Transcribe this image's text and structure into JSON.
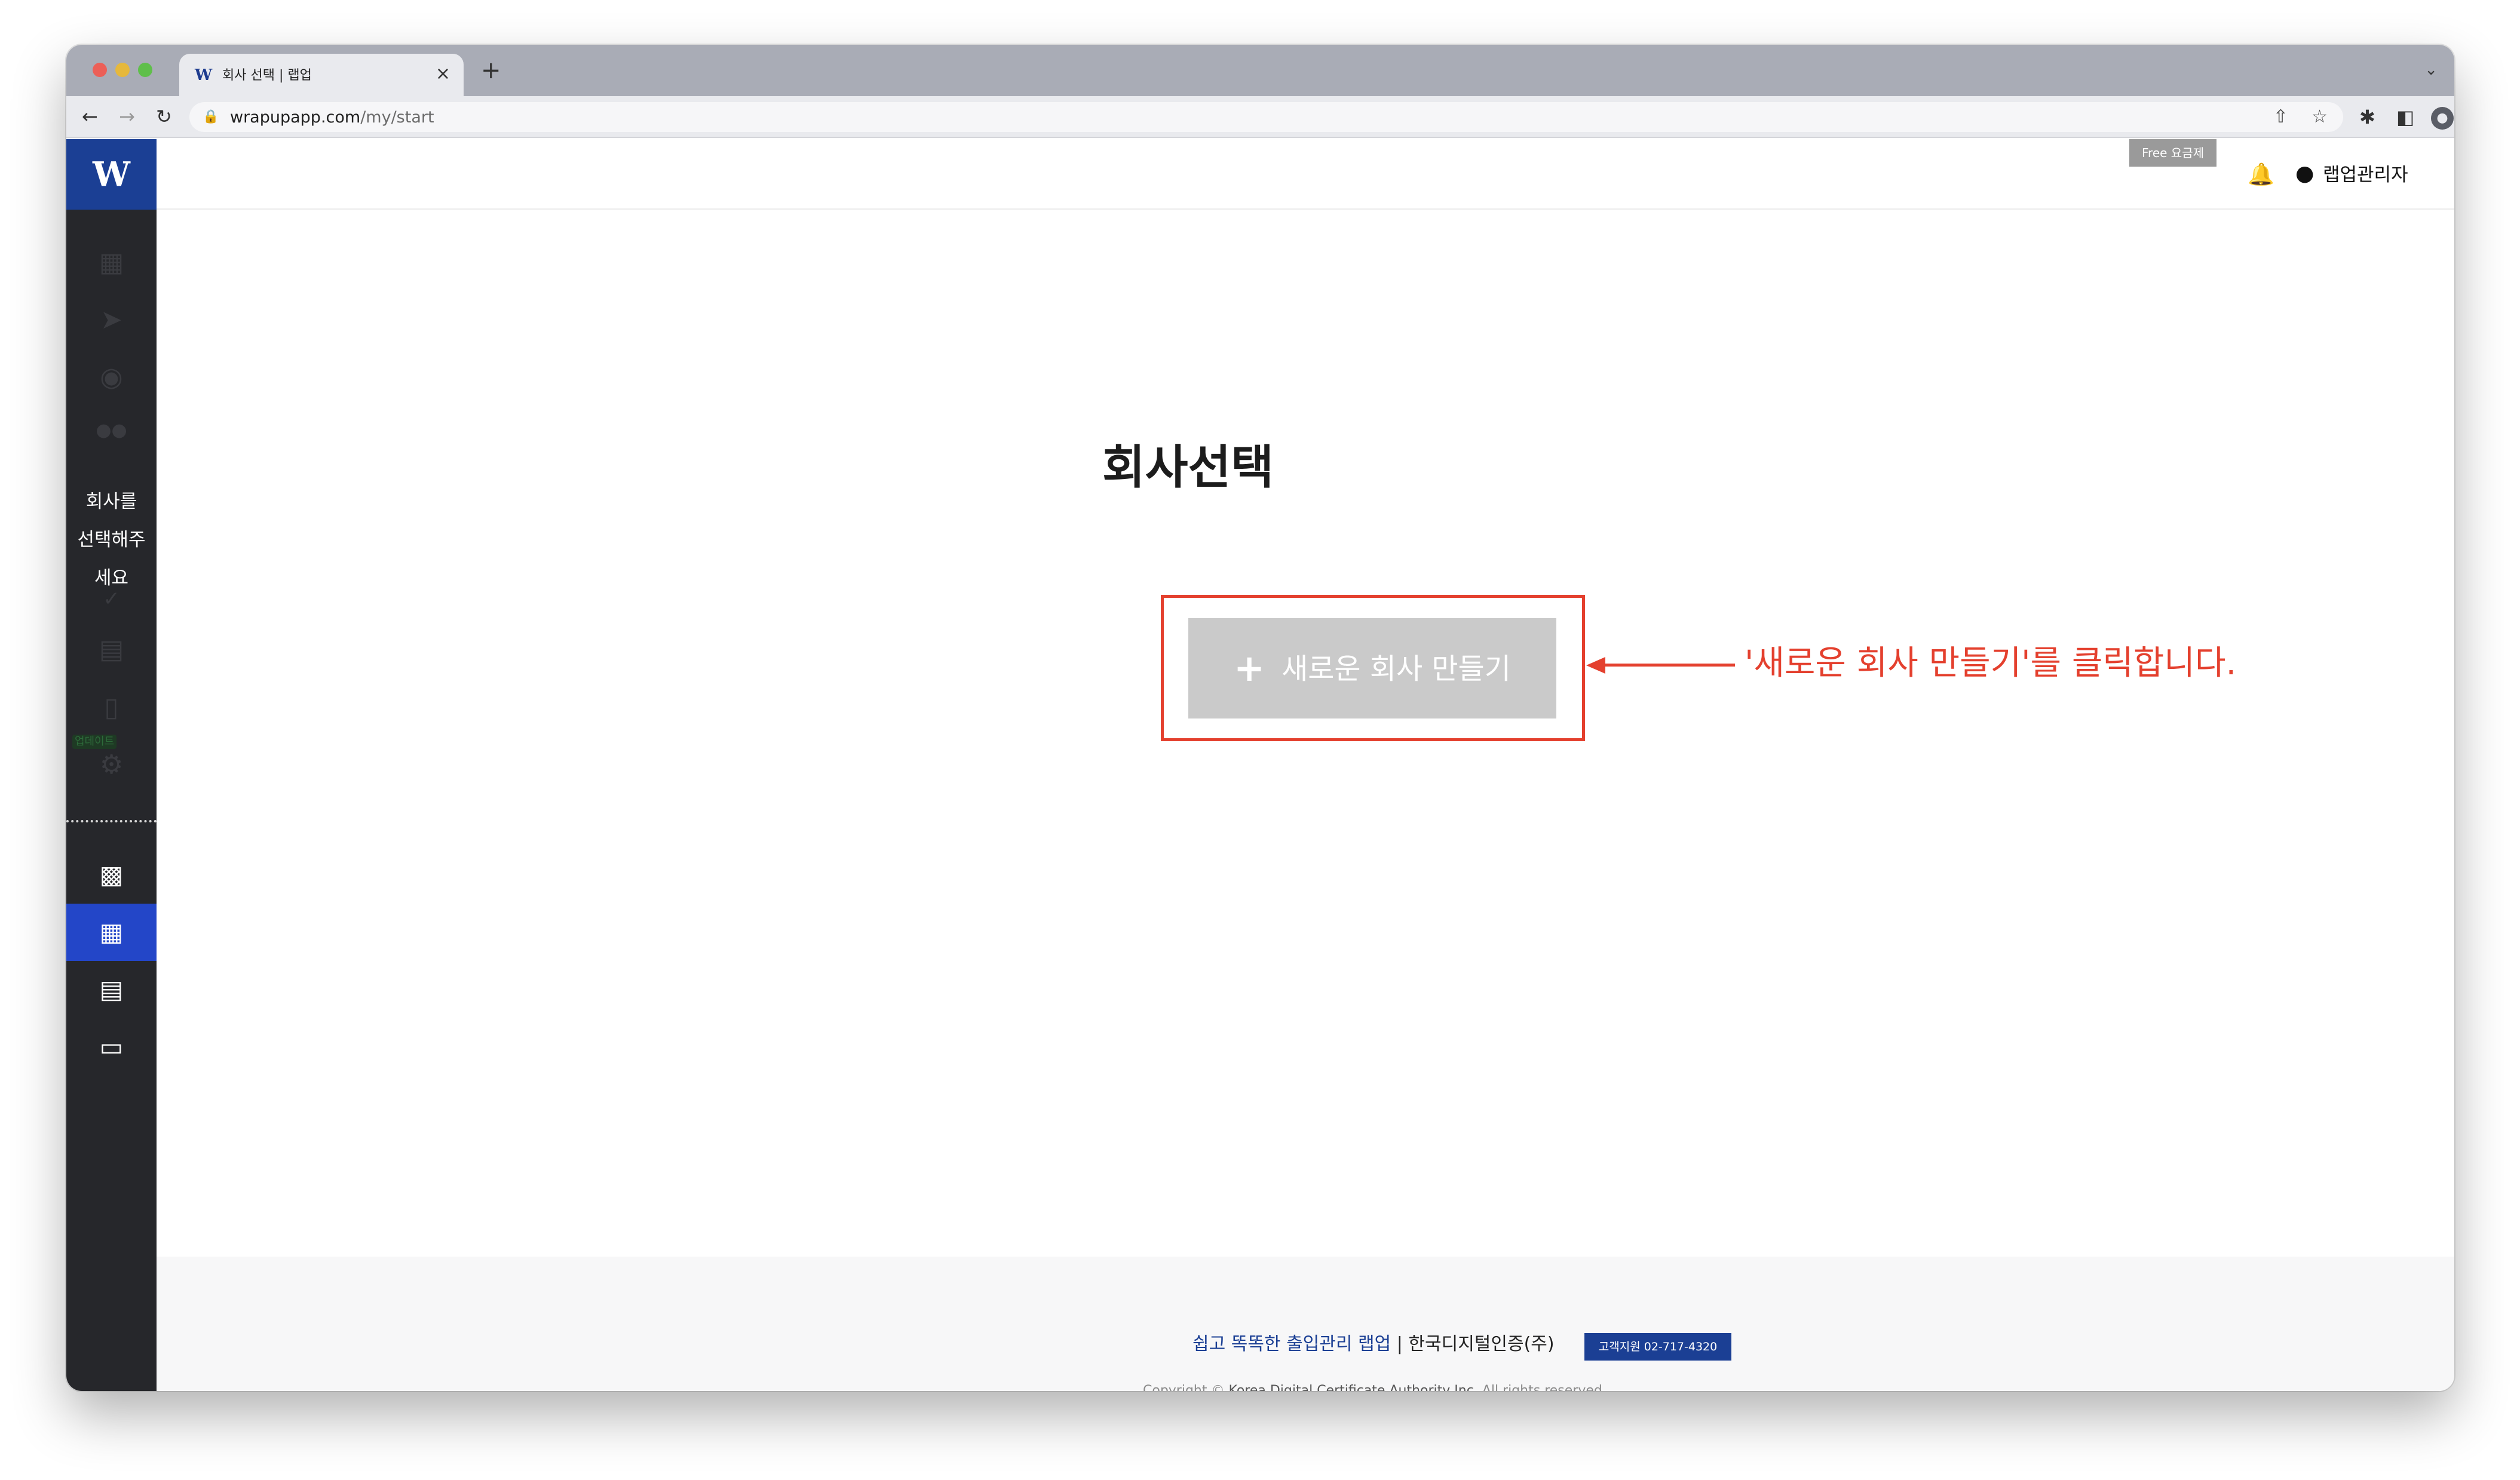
{
  "browser": {
    "tab_title": "회사 선택 | 랩업",
    "tab_favicon": "W",
    "tab_close": "×",
    "new_tab": "+",
    "tab_menu": "⌄",
    "url_domain": "wrapupapp.com",
    "url_path": "/my/start",
    "icons": [
      "back-arrow-icon",
      "forward-arrow-icon",
      "reload-icon",
      "lock-icon",
      "share-icon",
      "star-icon",
      "extensions-icon",
      "side-panel-icon",
      "profile-icon",
      "kebab-menu-icon"
    ]
  },
  "sidebar": {
    "logo": "W",
    "message": [
      "회사를",
      "선택해주",
      "세요"
    ],
    "update_badge": "업데이트",
    "icons": [
      "dashboard-icon",
      "rocket-icon",
      "palette-icon",
      "people-icon",
      "check-icon",
      "id-card-icon",
      "mobile-icon",
      "gear-icon",
      "contact-card-icon",
      "building-icon",
      "store-icon",
      "chat-icon"
    ],
    "active_item": "building-icon"
  },
  "topbar": {
    "plan_badge": "Free 요금제",
    "user_name": "랩업관리자"
  },
  "main": {
    "title": "회사선택",
    "create_button_label": "새로운 회사 만들기"
  },
  "annotation": {
    "text": "'새로운 회사 만들기'를 클릭합니다.",
    "color": "#e4402e"
  },
  "footer": {
    "slogan": "쉽고 똑똑한 출입관리 랩업",
    "separator": " | ",
    "company": "한국디지털인증(주)",
    "support": "고객지원 02-717-4320",
    "copyright_prefix": "Copyright © ",
    "copyright_company": "Korea Digital Certificate Authority Inc.",
    "copyright_suffix": " All rights reserved."
  },
  "colors": {
    "brand": "#1b3f94",
    "sidebar_bg": "#26272b",
    "active_item": "#2346c8",
    "button_bg": "#cacaca",
    "annotation": "#e4402e"
  }
}
